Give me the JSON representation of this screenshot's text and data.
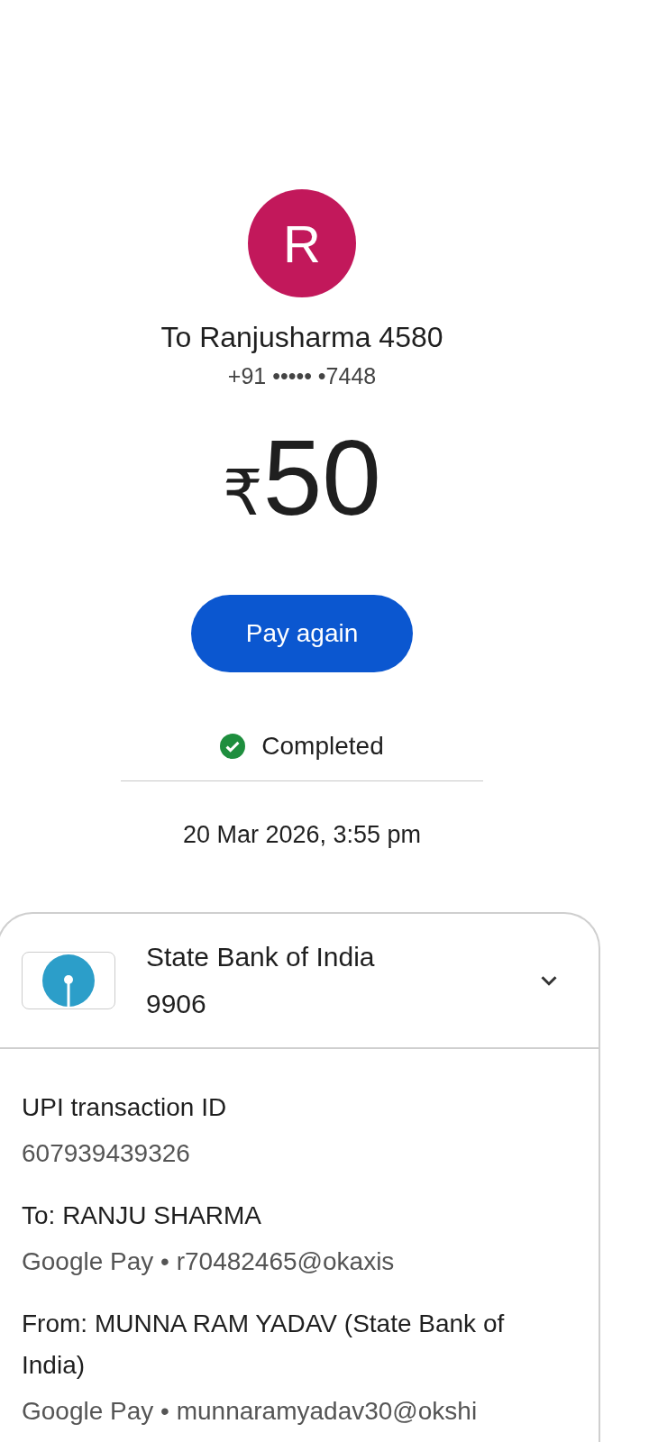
{
  "payee": {
    "initial": "R",
    "title": "To Ranjusharma 4580",
    "phone": "+91 ••••• •7448"
  },
  "amount": {
    "currency": "₹",
    "value": "50"
  },
  "pay_again_button": {
    "label": "Pay again"
  },
  "status": {
    "kind": "success",
    "label": "Completed"
  },
  "timestamp": "20 Mar 2026, 3:55 pm",
  "account_card": {
    "bank_name": "State Bank of India",
    "account_suffix": "9906",
    "expanded": false,
    "details": [
      {
        "label": "UPI transaction ID",
        "value": "607939439326"
      },
      {
        "label": "To: RANJU  SHARMA",
        "value": "Google Pay • r70482465@okaxis"
      },
      {
        "label": "From: MUNNA RAM YADAV (State Bank of India)",
        "value": "Google Pay • munnaramyadav30@okshi"
      }
    ]
  }
}
